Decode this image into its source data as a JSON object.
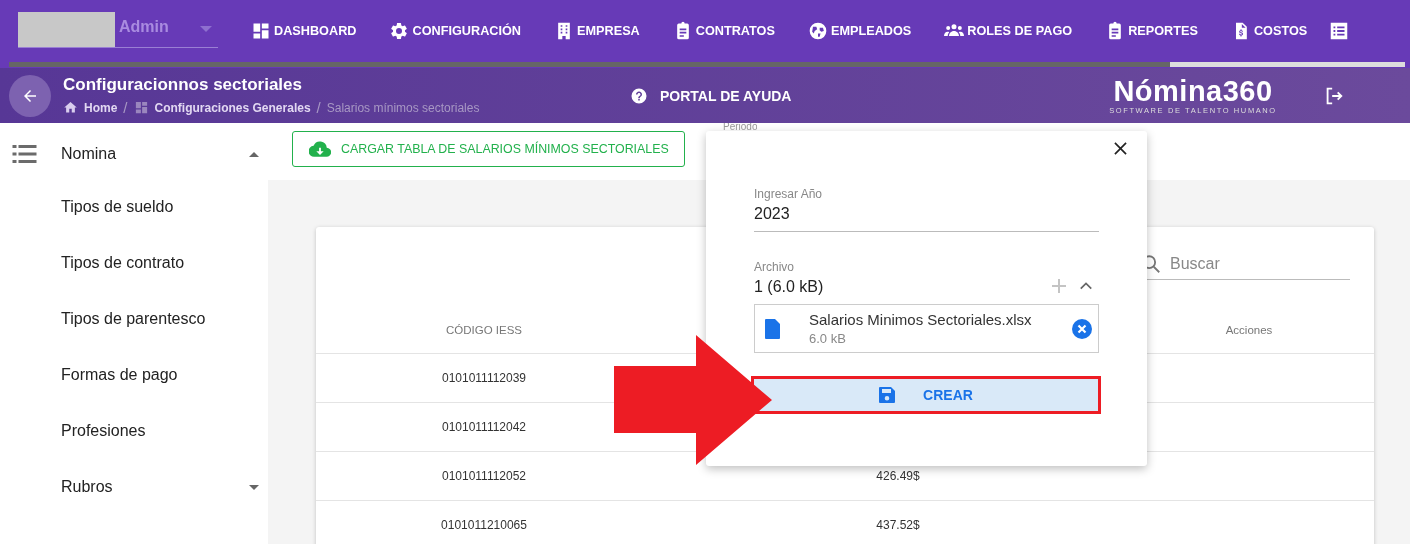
{
  "user": {
    "name": "Admin"
  },
  "nav": [
    {
      "label": "DASHBOARD"
    },
    {
      "label": "CONFIGURACIÓN"
    },
    {
      "label": "EMPRESA"
    },
    {
      "label": "CONTRATOS"
    },
    {
      "label": "EMPLEADOS"
    },
    {
      "label": "ROLES DE PAGO"
    },
    {
      "label": "REPORTES"
    },
    {
      "label": "COSTOS"
    }
  ],
  "header": {
    "title": "Configuracionnos sectoriales",
    "breadcrumb": [
      {
        "label": "Home",
        "current": false
      },
      {
        "label": "Configuraciones Generales",
        "current": false
      },
      {
        "label": "Salarios mínimos sectoriales",
        "current": true
      }
    ],
    "separator": "/",
    "help": "PORTAL DE AYUDA",
    "logo": "Nómina360",
    "tagline": "SOFTWARE DE TALENTO HUMANO"
  },
  "sidebar": {
    "items": [
      {
        "kind": "group",
        "label": "Nomina",
        "expanded": true,
        "children": [
          {
            "label": "Tipos de sueldo"
          },
          {
            "label": "Tipos de contrato"
          },
          {
            "label": "Tipos de parentesco"
          },
          {
            "label": "Formas de pago"
          },
          {
            "label": "Profesiones"
          }
        ]
      },
      {
        "kind": "group",
        "label": "Rubros",
        "expanded": false
      }
    ]
  },
  "upload_button": "CARGAR TABLA DE SALARIOS MÍNIMOS SECTORIALES",
  "period_label": "Periodo",
  "table": {
    "search": {
      "placeholder": "Buscar"
    },
    "header": {
      "column_1": "CÓDIGO IESS",
      "column_3": "Acciones"
    },
    "rows": [
      {
        "column_1": "0101011112039"
      },
      {
        "column_1": "0101011112042"
      },
      {
        "column_1": "0101011112052",
        "column_2": "426.49$"
      },
      {
        "column_1": "0101011210065",
        "column_2": "437.52$"
      }
    ]
  },
  "dialog": {
    "year": {
      "label": "Ingresar Año",
      "value": "2023"
    },
    "file": {
      "label": "Archivo",
      "summary": "1 (6.0 kB)",
      "name": "Salarios Minimos Sectoriales.xlsx",
      "size": "6.0 kB"
    },
    "submit": "CREAR"
  }
}
